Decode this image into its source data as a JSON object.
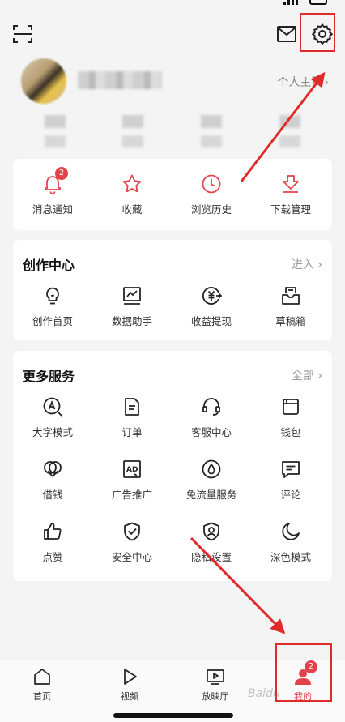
{
  "topbar": {
    "scan_icon": "scan-icon",
    "mail_icon": "mail-icon",
    "settings_icon": "gear-icon"
  },
  "profile": {
    "homepage_link": "个人主页",
    "chevron": "›"
  },
  "quick_actions": [
    {
      "label": "消息通知",
      "icon": "bell-icon",
      "badge": "2"
    },
    {
      "label": "收藏",
      "icon": "star-icon"
    },
    {
      "label": "浏览历史",
      "icon": "clock-icon"
    },
    {
      "label": "下载管理",
      "icon": "download-icon"
    }
  ],
  "creator_center": {
    "title": "创作中心",
    "more": "进入 ›",
    "items": [
      {
        "label": "创作首页",
        "icon": "lightbulb-icon"
      },
      {
        "label": "数据助手",
        "icon": "chart-icon"
      },
      {
        "label": "收益提现",
        "icon": "yuan-coin-icon"
      },
      {
        "label": "草稿箱",
        "icon": "draft-box-icon"
      }
    ]
  },
  "more_services": {
    "title": "更多服务",
    "more": "全部 ›",
    "items": [
      {
        "label": "大字模式",
        "icon": "large-font-icon"
      },
      {
        "label": "订单",
        "icon": "order-icon"
      },
      {
        "label": "客服中心",
        "icon": "headset-icon"
      },
      {
        "label": "钱包",
        "icon": "wallet-icon"
      },
      {
        "label": "借钱",
        "icon": "loan-icon"
      },
      {
        "label": "广告推广",
        "icon": "ad-icon"
      },
      {
        "label": "免流量服务",
        "icon": "data-free-icon"
      },
      {
        "label": "评论",
        "icon": "comment-icon"
      },
      {
        "label": "点赞",
        "icon": "thumbs-up-icon"
      },
      {
        "label": "安全中心",
        "icon": "shield-check-icon"
      },
      {
        "label": "隐私设置",
        "icon": "privacy-icon"
      },
      {
        "label": "深色模式",
        "icon": "moon-icon"
      }
    ]
  },
  "tabbar": [
    {
      "label": "首页",
      "icon": "home-icon"
    },
    {
      "label": "视频",
      "icon": "play-icon"
    },
    {
      "label": "放映厅",
      "icon": "tv-icon"
    },
    {
      "label": "我的",
      "icon": "user-icon",
      "badge": "2",
      "active": true
    }
  ],
  "watermark": "Baidu",
  "colors": {
    "accent": "#e3424b",
    "annotation": "#e02b2b",
    "card_bg": "#ffffff",
    "page_bg": "#f4f4f4"
  }
}
